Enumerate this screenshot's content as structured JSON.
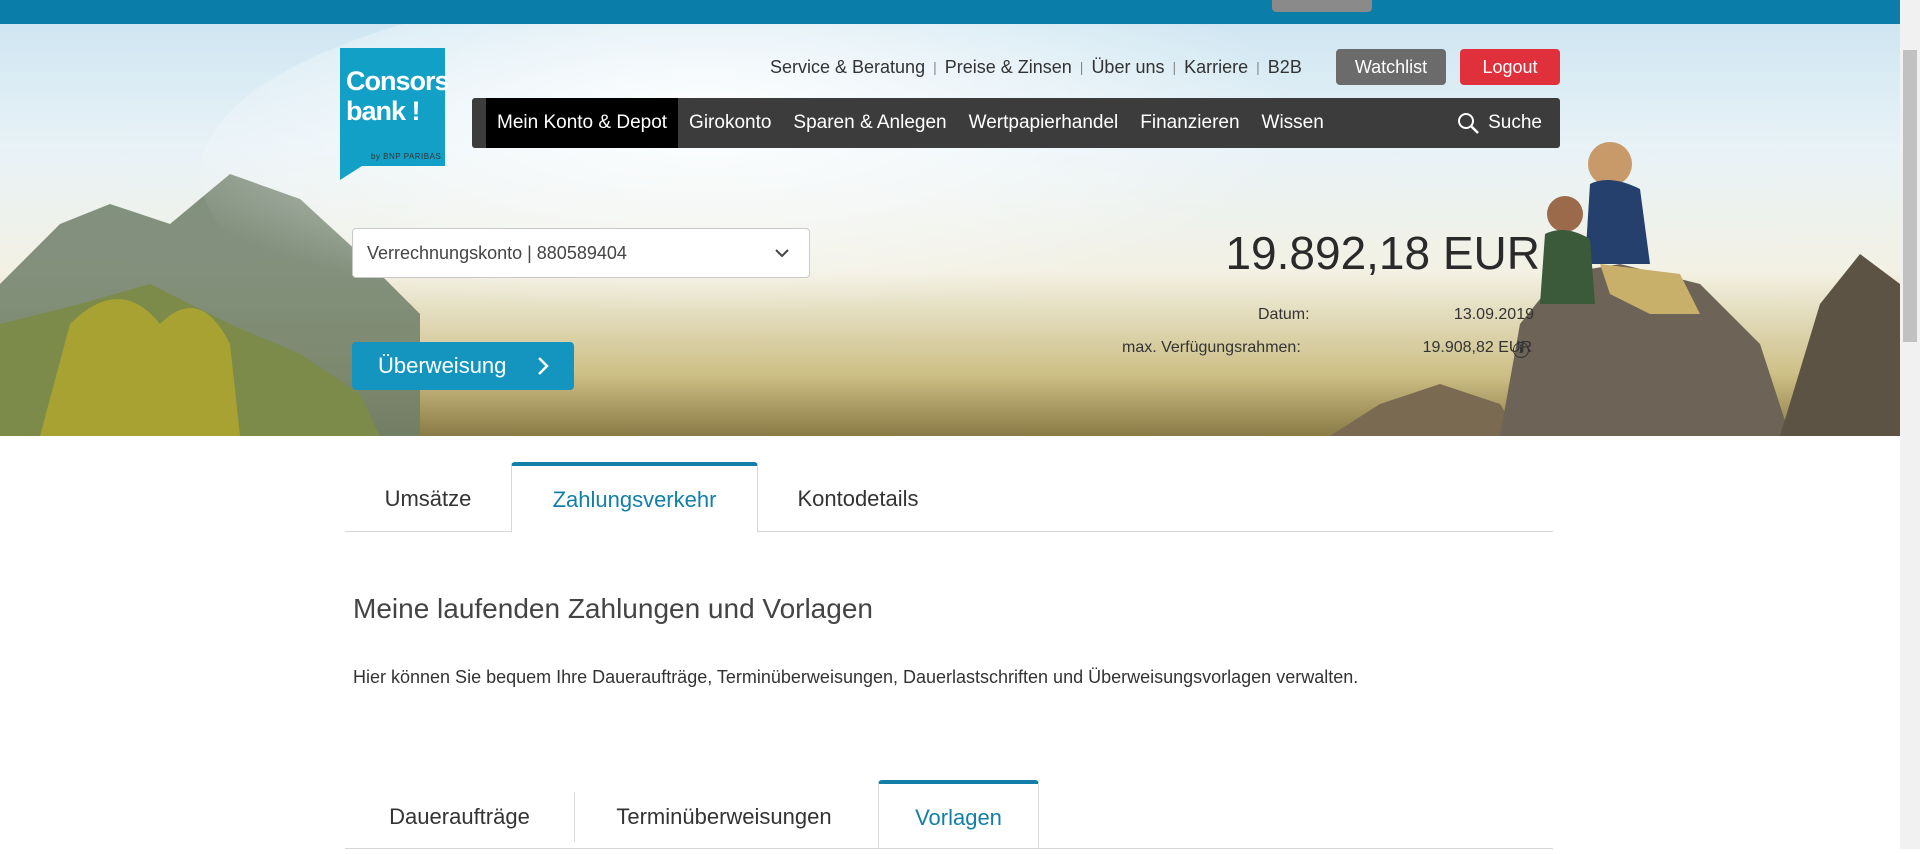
{
  "header": {
    "logo_line1": "Consors",
    "logo_line2": "bank !",
    "logo_sub": "by BNP PARIBAS",
    "toplinks": [
      "Service & Beratung",
      "Preise & Zinsen",
      "Über uns",
      "Karriere",
      "B2B"
    ],
    "watchlist_label": "Watchlist",
    "logout_label": "Logout"
  },
  "nav": {
    "items": [
      "Mein Konto & Depot",
      "Girokonto",
      "Sparen & Anlegen",
      "Wertpapierhandel",
      "Finanzieren",
      "Wissen"
    ],
    "search_label": "Suche"
  },
  "account": {
    "selected": "Verrechnungskonto | 880589404",
    "transfer_label": "Überweisung",
    "balance": "19.892,18 EUR",
    "date_label": "Datum:",
    "date_value": "13.09.2019",
    "limit_label": "max. Verfügungsrahmen:",
    "limit_value": "19.908,82 EUR"
  },
  "tabs": [
    "Umsätze",
    "Zahlungsverkehr",
    "Kontodetails"
  ],
  "section": {
    "title": "Meine laufenden Zahlungen und Vorlagen",
    "description": "Hier können Sie bequem Ihre Daueraufträge, Terminüberweisungen, Dauerlastschriften und Überweisungsvorlagen verwalten."
  },
  "subtabs": [
    "Daueraufträge",
    "Terminüberweisungen",
    "Vorlagen"
  ],
  "colors": {
    "brand": "#13a0c6",
    "accent": "#127fa8",
    "logout": "#e0303c",
    "nav_bg": "#3c3c3c"
  }
}
